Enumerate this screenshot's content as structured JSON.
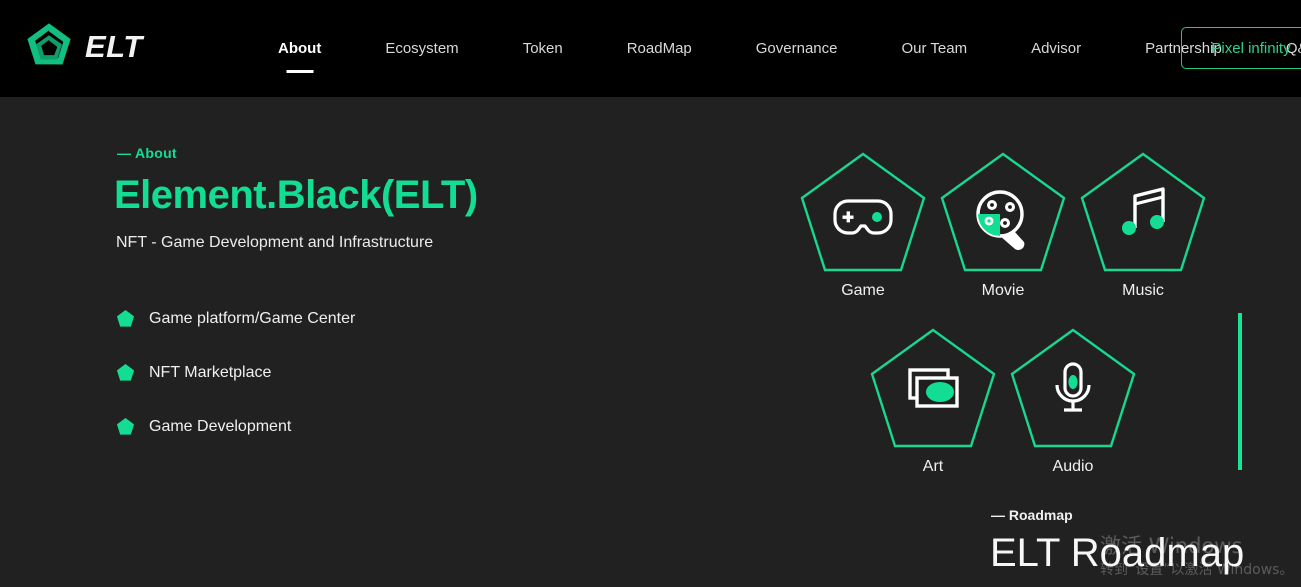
{
  "theme": {
    "header_bg": "#000000",
    "page_bg": "#212121",
    "accent_green": "#13dd93",
    "accent_green_line": "#17e595",
    "cta_border": "#21c97e",
    "text_white": "#f0f0f0"
  },
  "header": {
    "logo_text": "ELT",
    "nav_items": [
      {
        "label": "About",
        "active": true
      },
      {
        "label": "Ecosystem",
        "active": false
      },
      {
        "label": "Token",
        "active": false
      },
      {
        "label": "RoadMap",
        "active": false
      },
      {
        "label": "Governance",
        "active": false
      },
      {
        "label": "Our Team",
        "active": false
      },
      {
        "label": "Advisor",
        "active": false
      },
      {
        "label": "Partnership",
        "active": false
      },
      {
        "label": "Q&A",
        "active": false
      }
    ],
    "cta_label": "Pixel infinity"
  },
  "hero": {
    "eyebrow": "— About",
    "title": "Element.Black(ELT)",
    "subtitle": "NFT - Game Development and Infrastructure",
    "features": [
      {
        "label": "Game platform/Game Center"
      },
      {
        "label": "NFT Marketplace"
      },
      {
        "label": "Game Development"
      }
    ]
  },
  "categories": [
    {
      "label": "Game",
      "icon": "gamepad-icon"
    },
    {
      "label": "Movie",
      "icon": "film-reel-icon"
    },
    {
      "label": "Music",
      "icon": "music-note-icon"
    },
    {
      "label": "Art",
      "icon": "image-frames-icon"
    },
    {
      "label": "Audio",
      "icon": "microphone-icon"
    }
  ],
  "roadmap": {
    "eyebrow": "— Roadmap",
    "title": "ELT Roadmap"
  },
  "watermark": {
    "title": "激活 Windows",
    "subtitle": "转到“设置”以激活 Windows。"
  }
}
